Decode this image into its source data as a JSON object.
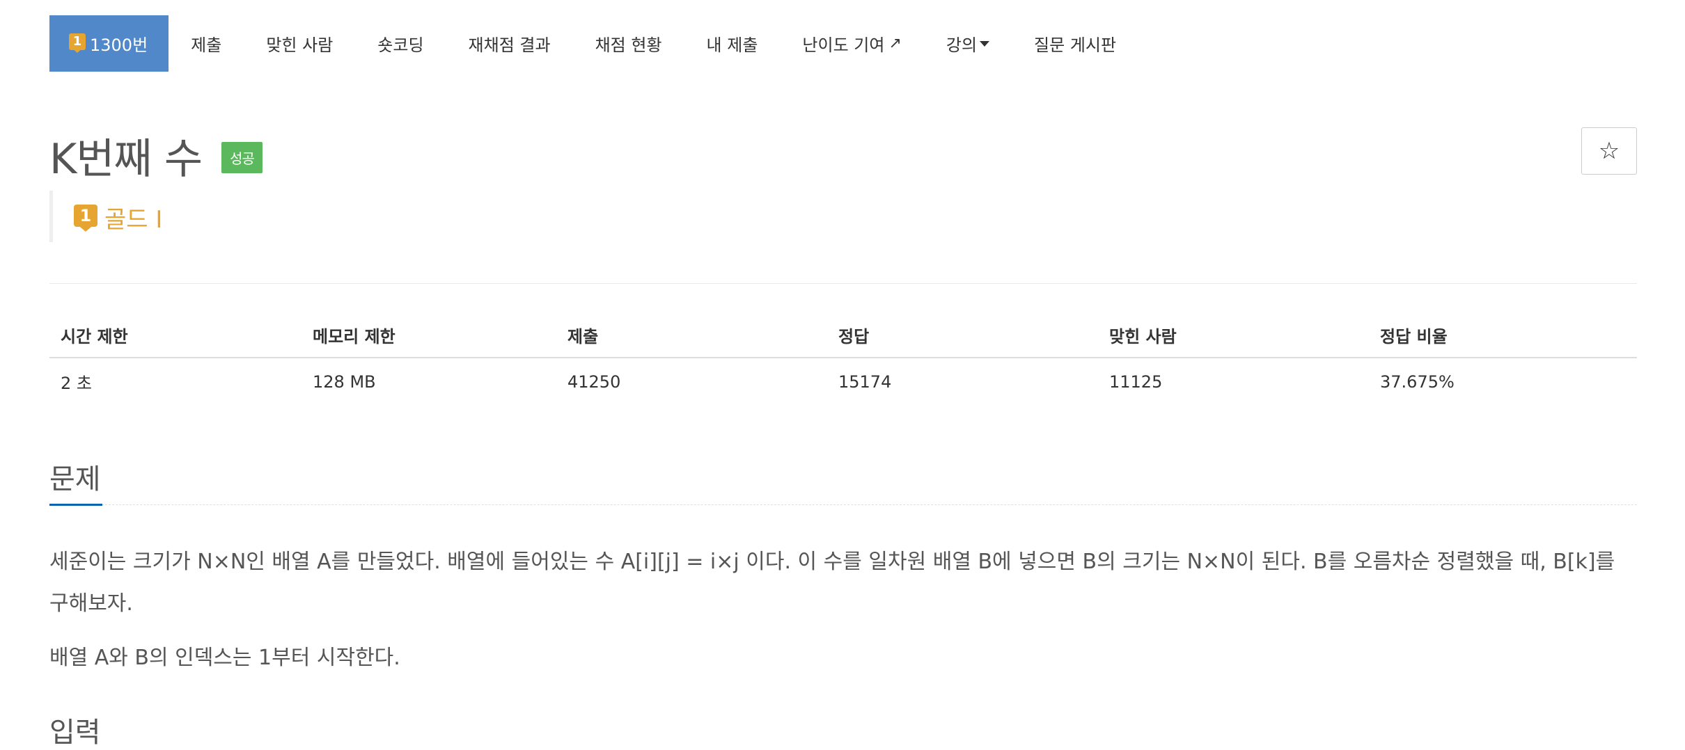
{
  "nav": {
    "active_label": "1300번",
    "tier_digit": "1",
    "items": [
      "제출",
      "맞힌 사람",
      "숏코딩",
      "재채점 결과",
      "채점 현황",
      "내 제출",
      "난이도 기여",
      "강의",
      "질문 게시판"
    ]
  },
  "problem": {
    "title": "K번째 수",
    "status_badge": "성공",
    "tier_label": "골드 I",
    "star": "☆"
  },
  "info_table": {
    "headers": [
      "시간 제한",
      "메모리 제한",
      "제출",
      "정답",
      "맞힌 사람",
      "정답 비율"
    ],
    "values": [
      "2 초",
      "128 MB",
      "41250",
      "15174",
      "11125",
      "37.675%"
    ]
  },
  "sections": {
    "problem_heading": "문제",
    "problem_p1": "세준이는 크기가 N×N인 배열 A를 만들었다. 배열에 들어있는 수 A[i][j] = i×j 이다. 이 수를 일차원 배열 B에 넣으면 B의 크기는 N×N이 된다. B를 오름차순 정렬했을 때, B[k]를 구해보자.",
    "problem_p2": "배열 A와 B의 인덱스는 1부터 시작한다.",
    "input_heading": "입력"
  },
  "colors": {
    "nav_active": "#5088c9",
    "tier_gold": "#e6a531",
    "badge_success": "#5cb85c",
    "section_accent": "#0b63b0"
  }
}
